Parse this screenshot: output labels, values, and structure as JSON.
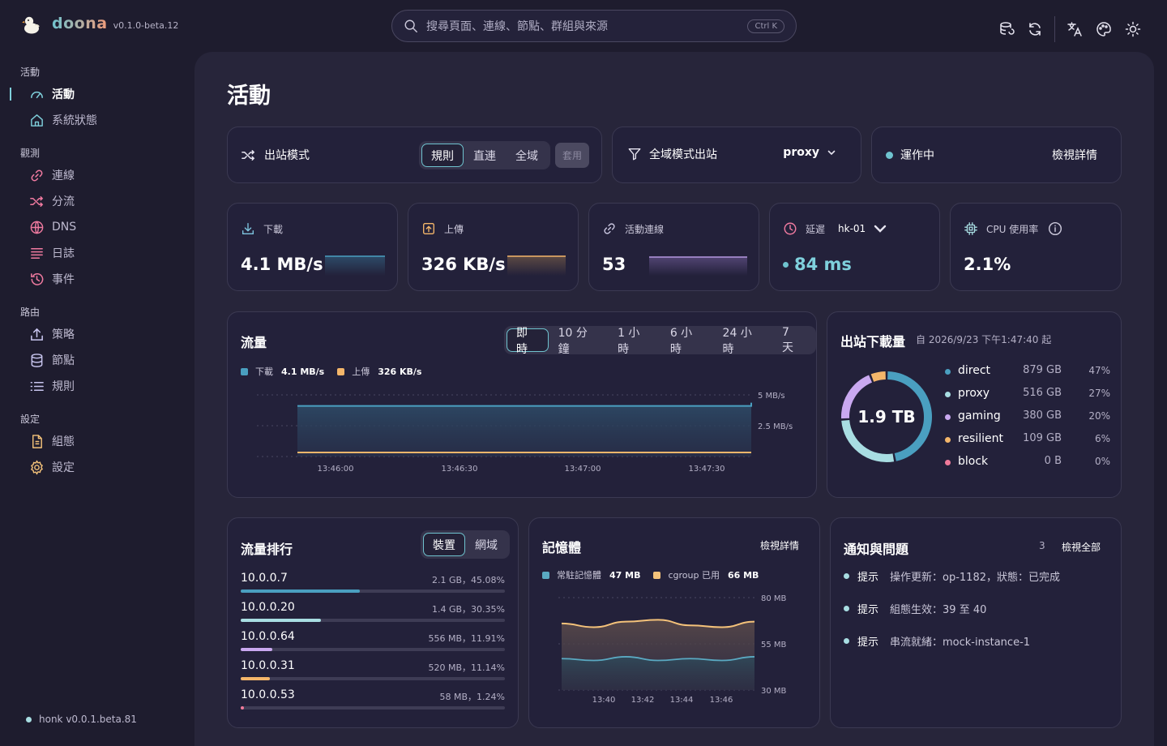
{
  "app": {
    "name": "doona",
    "version": "v0.1.0-beta.12"
  },
  "search": {
    "placeholder": "搜尋頁面、連線、節點、群組與來源",
    "shortcut": "Ctrl K"
  },
  "sidebar": {
    "groups": [
      {
        "label": "活動",
        "items": [
          {
            "label": "活動",
            "icon": "gauge-icon",
            "active": true
          },
          {
            "label": "系統狀態",
            "icon": "home-icon"
          }
        ]
      },
      {
        "label": "觀測",
        "items": [
          {
            "label": "連線",
            "icon": "link-icon"
          },
          {
            "label": "分流",
            "icon": "shuffle-icon"
          },
          {
            "label": "DNS",
            "icon": "globe-icon"
          },
          {
            "label": "日誌",
            "icon": "lines-icon"
          },
          {
            "label": "事件",
            "icon": "history-icon"
          }
        ]
      },
      {
        "label": "路由",
        "items": [
          {
            "label": "策略",
            "icon": "upload-icon"
          },
          {
            "label": "節點",
            "icon": "database-icon"
          },
          {
            "label": "規則",
            "icon": "list-icon"
          }
        ]
      },
      {
        "label": "設定",
        "items": [
          {
            "label": "組態",
            "icon": "file-icon"
          },
          {
            "label": "設定",
            "icon": "gear-icon"
          }
        ]
      }
    ],
    "footer": "honk v0.0.1.beta.81"
  },
  "page": {
    "title": "活動"
  },
  "mode": {
    "label": "出站模式",
    "options": [
      "規則",
      "直連",
      "全域"
    ],
    "selected": "規則",
    "apply": "套用"
  },
  "global_outbound": {
    "label": "全域模式出站",
    "value": "proxy"
  },
  "status": {
    "label": "運作中",
    "link": "檢視詳情",
    "color": "#6fc3cf"
  },
  "stats": {
    "download": {
      "label": "下載",
      "value": "4.1 MB/s"
    },
    "upload": {
      "label": "上傳",
      "value": "326 KB/s"
    },
    "connections": {
      "label": "活動連線",
      "value": "53"
    },
    "latency": {
      "label": "延遲",
      "node": "hk-01",
      "value": "84 ms"
    },
    "cpu": {
      "label": "CPU 使用率",
      "value": "2.1%"
    }
  },
  "traffic": {
    "title": "流量",
    "ranges": [
      "即時",
      "10 分鐘",
      "1 小時",
      "6 小時",
      "24 小時",
      "7 天"
    ],
    "selected": "即時",
    "legend": [
      {
        "name": "下載",
        "value": "4.1 MB/s",
        "color": "#4a9fc0"
      },
      {
        "name": "上傳",
        "value": "326 KB/s",
        "color": "#f4b66a"
      }
    ]
  },
  "chart_data": [
    {
      "type": "area",
      "title": "流量",
      "x": [
        "13:46:00",
        "13:46:30",
        "13:47:00",
        "13:47:30"
      ],
      "y_ticks": [
        "5 MB/s",
        "2.5 MB/s"
      ],
      "ylim": [
        0,
        5
      ],
      "y_unit": "MB/s",
      "series": [
        {
          "name": "下載",
          "values": [
            4.1,
            4.1,
            4.1,
            4.1
          ],
          "color": "#4a9fc0"
        },
        {
          "name": "上傳",
          "values": [
            0.33,
            0.33,
            0.33,
            0.33
          ],
          "color": "#f4b66a"
        }
      ]
    },
    {
      "type": "area",
      "title": "記憶體",
      "x": [
        "13:40",
        "13:42",
        "13:44",
        "13:46"
      ],
      "y_ticks": [
        "80 MB",
        "55 MB",
        "30 MB"
      ],
      "ylim": [
        30,
        80
      ],
      "y_unit": "MB",
      "series": [
        {
          "name": "常駐記憶體",
          "values": [
            47,
            46,
            48,
            46,
            47,
            46,
            48
          ],
          "color": "#5aa9c2"
        },
        {
          "name": "cgroup 已用",
          "values": [
            66,
            64,
            67,
            68,
            65,
            64,
            67
          ],
          "color": "#f4c27a"
        }
      ]
    },
    {
      "type": "pie",
      "title": "出站下載量",
      "total": "1.9 TB",
      "categories": [
        "direct",
        "proxy",
        "gaming",
        "resilient",
        "block"
      ],
      "values": [
        47,
        27,
        20,
        6,
        0
      ]
    }
  ],
  "outbound": {
    "title": "出站下載量",
    "since": "自 2026/9/23 下午1:47:40 起",
    "total": "1.9 TB",
    "items": [
      {
        "name": "direct",
        "size": "879 GB",
        "pct": "47%",
        "color": "#4a9fc0"
      },
      {
        "name": "proxy",
        "size": "516 GB",
        "pct": "27%",
        "color": "#a8dde2"
      },
      {
        "name": "gaming",
        "size": "380 GB",
        "pct": "20%",
        "color": "#c9a8f0"
      },
      {
        "name": "resilient",
        "size": "109 GB",
        "pct": "6%",
        "color": "#f4b66a"
      },
      {
        "name": "block",
        "size": "0 B",
        "pct": "0%",
        "color": "#f07a9a"
      }
    ]
  },
  "ranking": {
    "title": "流量排行",
    "tabs": [
      "裝置",
      "網域"
    ],
    "selected": "裝置",
    "rows": [
      {
        "ip": "10.0.0.7",
        "value": "2.1 GB，45.08%",
        "share": 0.4508,
        "color": "#4a9fc0"
      },
      {
        "ip": "10.0.0.20",
        "value": "1.4 GB，30.35%",
        "share": 0.3035,
        "color": "#a8dde2"
      },
      {
        "ip": "10.0.0.64",
        "value": "556 MB，11.91%",
        "share": 0.1191,
        "color": "#c9a8f0"
      },
      {
        "ip": "10.0.0.31",
        "value": "520 MB，11.14%",
        "share": 0.1114,
        "color": "#f4b66a"
      },
      {
        "ip": "10.0.0.53",
        "value": "58 MB，1.24%",
        "share": 0.0124,
        "color": "#f07a9a"
      }
    ]
  },
  "memory": {
    "title": "記憶體",
    "link": "檢視詳情",
    "legend": [
      {
        "name": "常駐記憶體",
        "value": "47 MB",
        "color": "#5aa9c2"
      },
      {
        "name": "cgroup 已用",
        "value": "66 MB",
        "color": "#f4c27a"
      }
    ]
  },
  "notifications": {
    "title": "通知與問題",
    "count": "3",
    "link": "檢視全部",
    "items": [
      {
        "tag": "提示",
        "msg": "操作更新：op-1182，狀態：已完成"
      },
      {
        "tag": "提示",
        "msg": "組態生效：39 至 40"
      },
      {
        "tag": "提示",
        "msg": "串流就緒：mock-instance-1"
      }
    ]
  }
}
